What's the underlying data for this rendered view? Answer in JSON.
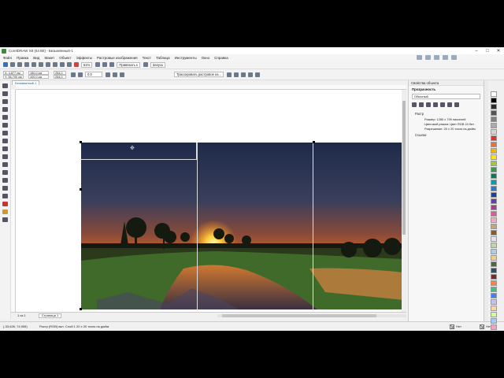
{
  "window": {
    "title": "CorelDRAW X8 (64 Bit) - Безымянный-1",
    "controls": [
      "–",
      "□",
      "✕"
    ]
  },
  "menu": [
    "Файл",
    "Правка",
    "Вид",
    "Макет",
    "Объект",
    "Эффекты",
    "Растровые изображения",
    "Текст",
    "Таблица",
    "Инструменты",
    "Окно",
    "Справка"
  ],
  "toolbar1": {
    "zoom": "61%",
    "snap": "Привязать к",
    "launch": "Запуск"
  },
  "propbar": {
    "x": "X: 4,877 см",
    "y": "Y: 36,700 см",
    "w": "150,0 см",
    "h": "100,0 см",
    "w2": "254,0",
    "h2": "254,0",
    "angle": "0,0",
    "trace": "Трассировать растровое из..."
  },
  "document_tab": "Безымянный-1",
  "page_tab": "Страница 1",
  "page_nav": "1 из 1",
  "status": {
    "coords": "(-33,626; 74,955)",
    "info": "Растр (RGB) вкл. Слой 1 20 x 20 точек на дюйм",
    "fill_label": "Нет",
    "stroke_label": "Нет"
  },
  "dock": {
    "title": "Свойства объекта",
    "section1": "Прозрачность",
    "mode": "Обычный",
    "raster_label": "Растр",
    "size_line": "Размер: 1280 x 799 пикселей",
    "color_line": "Цветовой режим: Цвет RGB 24 бит",
    "res_line": "Разрешение: 20 x 20 точек на дюйм",
    "links_label": "Ссылки"
  },
  "palette_colors": [
    "#ffffff",
    "#000000",
    "#2b2b2b",
    "#555555",
    "#808080",
    "#aaaaaa",
    "#d4d4d4",
    "#e03030",
    "#e8703a",
    "#f4b400",
    "#ffe600",
    "#9acd32",
    "#2e9e4a",
    "#0a7a5a",
    "#00a0b0",
    "#2d79c7",
    "#1f3f8f",
    "#6a3da0",
    "#b03a8a",
    "#e05a9a",
    "#f6a6c0",
    "#c9a27a",
    "#8b5a2b",
    "#e4e4e4",
    "#b8d8a8",
    "#a8d0e8",
    "#f0d080",
    "#4a6a3a",
    "#305060",
    "#7a2a2a",
    "#ff8040",
    "#40c080",
    "#4080ff",
    "#c0c0ff",
    "#ffd0a0",
    "#ccff99",
    "#99ccff",
    "#ff99cc",
    "#666633",
    "#336666"
  ]
}
